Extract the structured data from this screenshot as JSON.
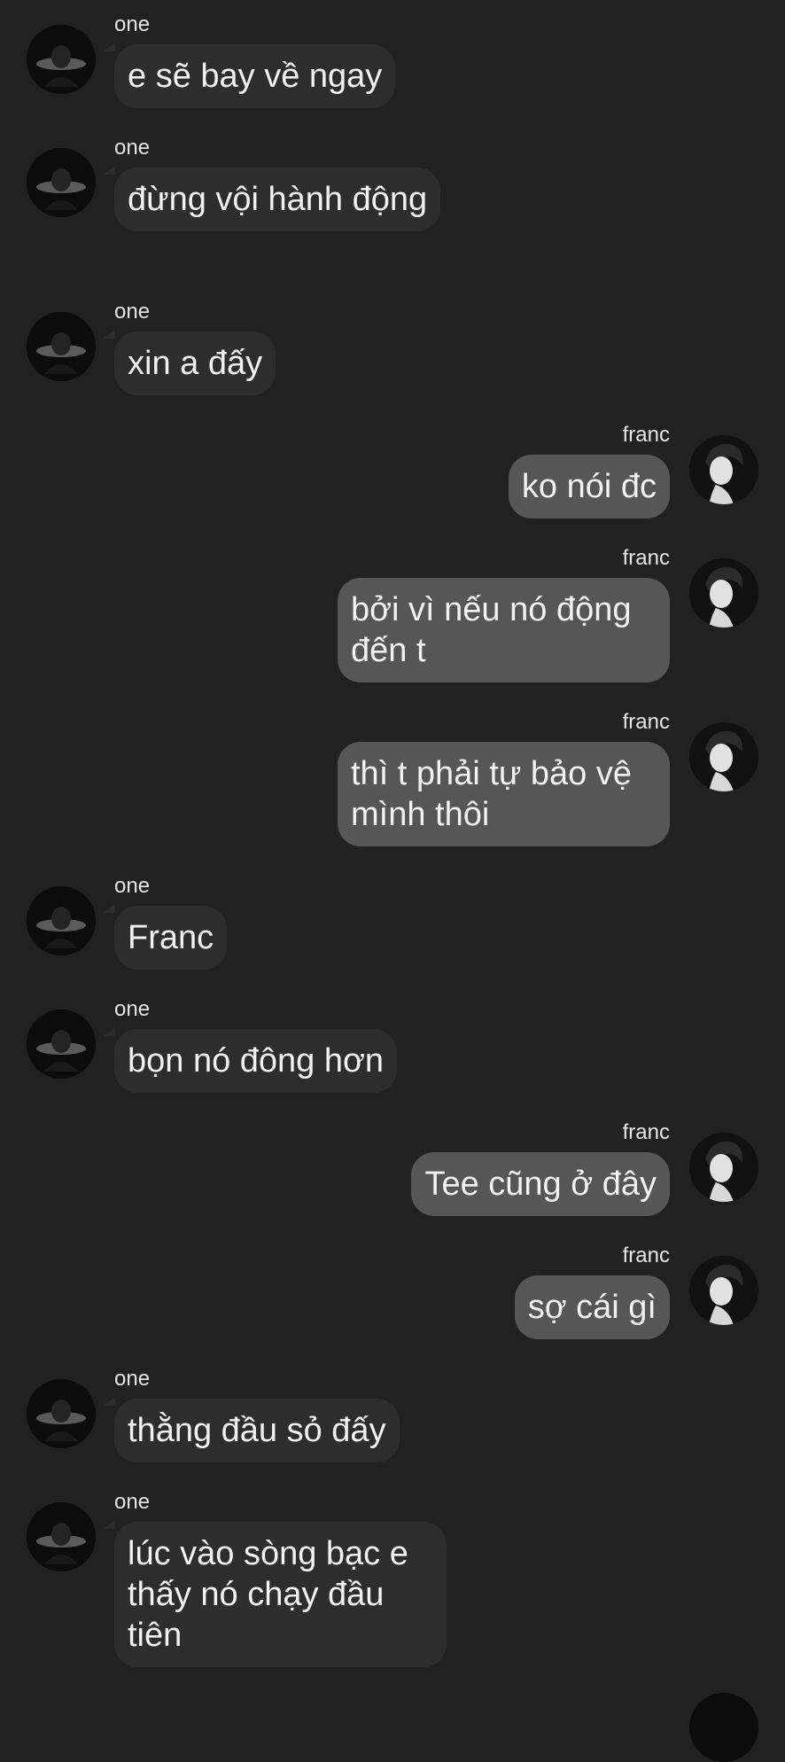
{
  "conversation": {
    "messages": [
      {
        "sender": "one",
        "side": "left",
        "avatar": "dark-photo-avatar",
        "text": "e sẽ bay về ngay"
      },
      {
        "sender": "one",
        "side": "left",
        "avatar": "dark-photo-avatar",
        "text": "đừng vội hành động"
      },
      {
        "sender": "one",
        "side": "left",
        "avatar": "dark-photo-avatar",
        "text": "xin a đấy"
      },
      {
        "sender": "franc",
        "side": "right",
        "avatar": "bw-portrait-avatar",
        "text": "ko nói đc"
      },
      {
        "sender": "franc",
        "side": "right",
        "avatar": "bw-portrait-avatar",
        "text": "bởi vì nếu nó động đến t"
      },
      {
        "sender": "franc",
        "side": "right",
        "avatar": "bw-portrait-avatar",
        "text": "thì t phải tự bảo vệ mình thôi"
      },
      {
        "sender": "one",
        "side": "left",
        "avatar": "dark-photo-avatar",
        "text": "Franc"
      },
      {
        "sender": "one",
        "side": "left",
        "avatar": "dark-photo-avatar",
        "text": "bọn nó đông hơn"
      },
      {
        "sender": "franc",
        "side": "right",
        "avatar": "bw-portrait-avatar",
        "text": "Tee cũng ở đây"
      },
      {
        "sender": "franc",
        "side": "right",
        "avatar": "bw-portrait-avatar",
        "text": "sợ cái gì"
      },
      {
        "sender": "one",
        "side": "left",
        "avatar": "dark-photo-avatar",
        "text": "thằng đầu sỏ đấy"
      },
      {
        "sender": "one",
        "side": "left",
        "avatar": "dark-photo-avatar",
        "text": "lúc vào sòng bạc e thấy nó chạy đầu tiên"
      }
    ]
  },
  "colors": {
    "background": "#212121",
    "incoming_bubble": "#2d2d2d",
    "outgoing_bubble": "#565656",
    "text": "#f2f2f2"
  }
}
